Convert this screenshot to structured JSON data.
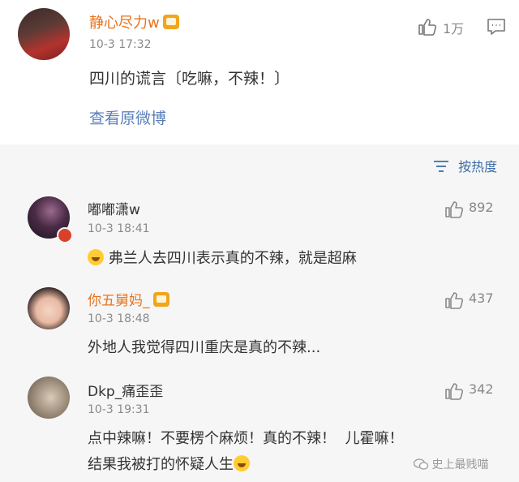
{
  "post": {
    "username": "静心尽力w",
    "time": "10-3 17:32",
    "likes": "1万",
    "content": "四川的谎言〔吃嘛，不辣！〕",
    "view_original": "查看原微博",
    "like_icon": "thumbs-up-icon",
    "comment_icon": "comment-icon"
  },
  "sort": {
    "label": "按热度",
    "icon": "sort-icon"
  },
  "comments": [
    {
      "username": "嘟嘟潇w",
      "time": "10-3 18:41",
      "likes": "892",
      "text": "弗兰人去四川表示真的不辣，就是超麻"
    },
    {
      "username": "你五舅妈_",
      "time": "10-3 18:48",
      "likes": "437",
      "text": "外地人我觉得四川重庆是真的不辣..."
    },
    {
      "username": "Dkp_痛歪歪",
      "time": "10-3 19:31",
      "likes": "342",
      "text_line1": "点中辣嘛！不要楞个麻烦！真的不辣！  儿霍嘛！",
      "text_line2": "结果我被打的怀疑人生"
    }
  ],
  "watermark": "史上最贱喵",
  "colors": {
    "orange_name": "#e8731d",
    "link_blue": "#5a7fb8",
    "feed_bg": "#f6f6f6"
  }
}
